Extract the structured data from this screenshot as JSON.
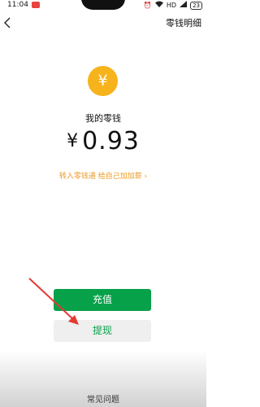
{
  "status_bar": {
    "time": "11:04",
    "network_label": "HD",
    "battery": "23"
  },
  "header": {
    "details_label": "零钱明细"
  },
  "wallet": {
    "coin_symbol": "¥",
    "label": "我的零钱",
    "currency": "¥",
    "amount": "0.93",
    "transfer_link": "转入零钱通 给自己加加薪 ›"
  },
  "buttons": {
    "recharge_label": "充值",
    "withdraw_label": "提现"
  },
  "footer": {
    "faq_label": "常见问题"
  },
  "colors": {
    "coin": "#f6b31c",
    "primary_green": "#07a14a",
    "link_orange": "#ee9a1f",
    "annotation_red": "#e53935"
  }
}
